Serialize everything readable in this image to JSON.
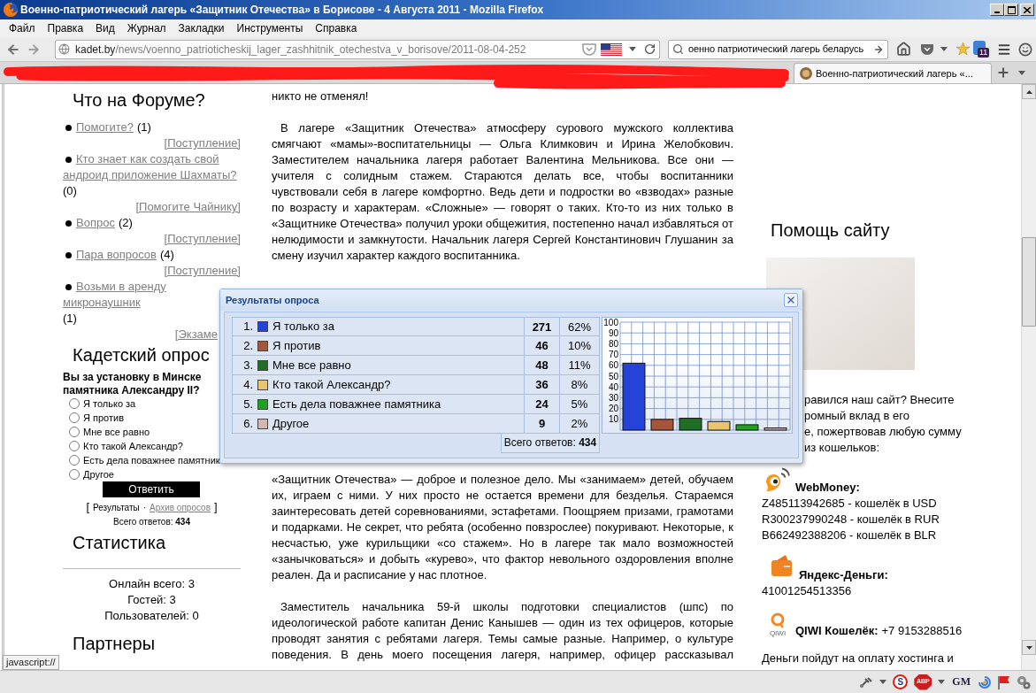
{
  "window": {
    "title": "Военно-патриотический лагерь «Защитник Отечества» в Борисове - 4 Августа 2011 - Mozilla Firefox"
  },
  "menu": [
    "Файл",
    "Правка",
    "Вид",
    "Журнал",
    "Закладки",
    "Инструменты",
    "Справка"
  ],
  "address_bar": {
    "host": "kadet.by",
    "path": "/news/voenno_patrioticheskij_lager_zashhitnik_otechestva_v_borisove/2011-08-04-252"
  },
  "search": {
    "value": "оенно патриотический лагерь беларусь"
  },
  "toolbar_badge": "11",
  "tabs": [
    {
      "label": "Военно-патриотический лагерь «...",
      "selected": true
    }
  ],
  "forum": {
    "title": "Что на Форуме?",
    "items": [
      {
        "topic": "Помогите?",
        "count": "(1)",
        "category": "[Поступление]"
      },
      {
        "topic": "Кто знает как создать свой андроид приложение Шахматы?",
        "count": "(0)",
        "category": "[Помогите Чайнику]"
      },
      {
        "topic": "Вопрос",
        "count": "(2)",
        "category": "[Поступление]"
      },
      {
        "topic": "Пара вопросов",
        "count": "(4)",
        "category": "[Поступление]"
      },
      {
        "topic": "Возьми в аренду микронаушник",
        "count": "(1)",
        "category": "[Экзаме"
      }
    ]
  },
  "poll": {
    "title": "Кадетский опрос",
    "question": "Вы за установку в Минске памятника Александру II?",
    "options": [
      {
        "label": "Я только за",
        "selected": false
      },
      {
        "label": "Я против",
        "selected": false
      },
      {
        "label": "Мне все равно",
        "selected": false
      },
      {
        "label": "Кто такой Александр?",
        "selected": false
      },
      {
        "label": "Есть дела поважнее памятник",
        "selected": false
      },
      {
        "label": "Другое",
        "selected": false
      }
    ],
    "submit": "Ответить",
    "links": {
      "open": "[",
      "results": "Результаты",
      "separator": "·",
      "archive": "Архив опросов",
      "close": "]"
    },
    "total": "Всего ответов: **434**"
  },
  "stats": {
    "title": "Статистика",
    "lines": [
      "Онлайн всего: 3",
      "Гостей: 3",
      "Пользователей: 0"
    ]
  },
  "partners": {
    "title": "Партнеры"
  },
  "article": {
    "before_popup": [
      {
        "kind": "continued",
        "text": "никто не отменял!"
      },
      {
        "kind": "new",
        "text": "В лагере «Защитник Отечества» атмосферу сурового мужского коллектива смягчают «мамы»-воспитательницы — Ольга Климкович и Ирина Желобкович. Заместителем начальника лагеря работает Валентина Мельникова. Все они — учителя с солидным стажем. Стараются делать все, чтобы воспитанники чувствовали себя в лагере комфортно. Ведь дети и подростки во «взводах» разные по возрасту и характерам. «Сложные» — говорят о таких. Кто-то из них только в «Защитнике Отечества» получил уроки общежития, постепенно начал избавляться от нелюдимости и замкнутости. Начальник лагеря Сергей Константинович Глушанин за смену изучил характер каждого воспитанника."
      }
    ],
    "after_popup": [
      {
        "kind": "continued",
        "text": "«Защитник Отечества» — доброе и полезное дело. Мы «занимаем» детей, обучаем их, играем с ними. У них просто не остается времени для безделья. Стараемся заинтересовать детей соревнованиями, эстафетами. Поощряем призами, грамотами и подарками. Не секрет, что ребята (особенно повзрослее) покуривают. Некоторые, к несчастью, уже курильщики «со стажем». Но в лагере так мало возможностей «занычковаться» и добыть «курево», что фактор невольного оздоровления вполне реален. Да и расписание у нас плотное."
      },
      {
        "kind": "new",
        "text": "Заместитель начальника 59-й школы подготовки специалистов (шпс) по идеологической работе капитан Денис Канышев — один из тех офицеров, которые проводят занятия с ребятами лагеря. Темы самые разные. Например, о культуре поведения. В день моего посещения лагеря, например, офицер рассказывал"
      }
    ]
  },
  "donate": {
    "title": "Помощь сайту",
    "text_fragments": [
      "равился наш сайт? Внесите",
      "ромный вклад в его",
      "е, пожертвовав любую сумму",
      "из кошельков:"
    ],
    "wallets": [
      {
        "kind": "mascot",
        "name": "WebMoney:",
        "lines": [
          "Z485113942685 - кошелёк в USD",
          "R300237990248 - кошелёк в RUR",
          "B662492388206 - кошелёк в BLR"
        ]
      },
      {
        "kind": "wallet",
        "name": "Яндекс-Деньги:",
        "lines": [
          "41001254513356"
        ]
      },
      {
        "kind": "ring",
        "icon_text": "QIWI",
        "name": "QIWI Кошелёк:",
        "value": "+7 9153288516"
      }
    ],
    "footer": "Деньги пойдут на оплату хостинга и"
  },
  "results": {
    "title": "Результаты опроса",
    "rows": [
      {
        "number": "1.",
        "label": "Я только за",
        "count": "271",
        "percent": "62%",
        "color": "#2543d8"
      },
      {
        "number": "2.",
        "label": "Я против",
        "count": "46",
        "percent": "10%",
        "color": "#a4553a"
      },
      {
        "number": "3.",
        "label": "Мне все равно",
        "count": "48",
        "percent": "11%",
        "color": "#1f6e26"
      },
      {
        "number": "4.",
        "label": "Кто такой Александр?",
        "count": "36",
        "percent": "8%",
        "color": "#ebc56d"
      },
      {
        "number": "5.",
        "label": "Есть дела поважнее памятника",
        "count": "24",
        "percent": "5%",
        "color": "#1ea31e"
      },
      {
        "number": "6.",
        "label": "Другое",
        "count": "9",
        "percent": "2%",
        "color": "#d4b6b0"
      }
    ],
    "total": "Всего ответов: **434**",
    "chart_data": {
      "type": "bar",
      "values": [
        62,
        10,
        11,
        8,
        5,
        2
      ],
      "ylim": [
        0,
        100
      ],
      "yticks": [
        10,
        20,
        30,
        40,
        50,
        60,
        70,
        80,
        90,
        100
      ],
      "grid": true
    }
  },
  "status_bar": {
    "link_hint": "javascript://",
    "addons": [
      {
        "kind": "tool"
      },
      {
        "kind": "caret"
      },
      {
        "kind": "letter_ring",
        "text": "S"
      },
      {
        "kind": "octagon",
        "text": "ABP"
      },
      {
        "kind": "caret"
      },
      {
        "kind": "letters",
        "text": "GM"
      },
      {
        "kind": "swirl"
      },
      {
        "kind": "flag"
      },
      {
        "kind": "gears"
      }
    ]
  }
}
